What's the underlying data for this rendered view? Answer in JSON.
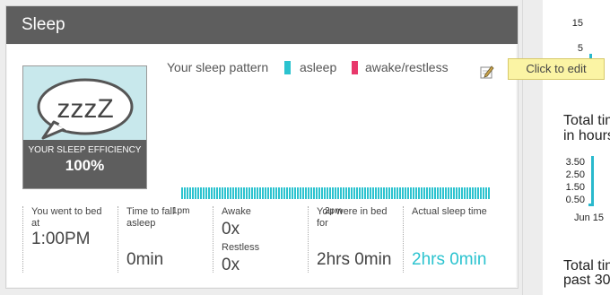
{
  "card": {
    "title": "Sleep"
  },
  "efficiency": {
    "bubble_text": "zzzZ",
    "label": "YOUR SLEEP EFFICIENCY",
    "value": "100%"
  },
  "legend": {
    "title": "Your sleep pattern",
    "asleep": "asleep",
    "awake": "awake/restless",
    "asleep_color": "#2bc3cf",
    "awake_color": "#e8386b"
  },
  "edit": {
    "icon": "edit-icon",
    "tooltip": "Click to edit"
  },
  "timeline": {
    "ticks": [
      "1pm",
      "2pm"
    ]
  },
  "stats": {
    "bed_label": "You went to bed at",
    "bed_value": "1:00PM",
    "fall_label": "Time to fall asleep",
    "fall_value": "0min",
    "awake_label": "Awake",
    "awake_value": "0x",
    "restless_label": "Restless",
    "restless_value": "0x",
    "inbed_label": "You were in bed for",
    "inbed_value": "2hrs 0min",
    "actual_label": "Actual sleep time",
    "actual_value": "2hrs 0min"
  },
  "right_panel": {
    "top_ticks": [
      "15",
      "5"
    ],
    "title1_line1": "Total tim",
    "title1_line2": "in hours",
    "ticks": [
      "3.50",
      "2.50",
      "1.50",
      "0.50"
    ],
    "date": "Jun 15",
    "title2_line1": "Total tim",
    "title2_line2": "past 30"
  }
}
